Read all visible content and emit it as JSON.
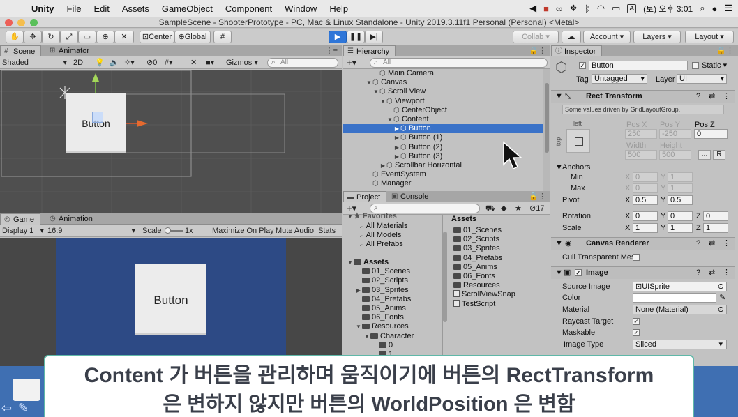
{
  "menubar": {
    "items": [
      "Unity",
      "File",
      "Edit",
      "Assets",
      "GameObject",
      "Component",
      "Window",
      "Help"
    ],
    "keyboard": "A",
    "datetime": "(토) 오후 3:01"
  },
  "window": {
    "title": "SampleScene - ShooterPrototype - PC, Mac & Linux Standalone - Unity 2019.3.11f1 Personal (Personal) <Metal>"
  },
  "toolbar": {
    "pivot": "Center",
    "space": "Global",
    "collab": "Collab",
    "account": "Account",
    "layers": "Layers",
    "layout": "Layout"
  },
  "scene": {
    "tabs": [
      "Scene",
      "Animator"
    ],
    "shading": "Shaded",
    "mode_2d": "2D",
    "hidden_count": "0",
    "gizmos": "Gizmos",
    "search_placeholder": "All",
    "button_label": "Button"
  },
  "game": {
    "tabs": [
      "Game",
      "Animation"
    ],
    "display": "Display 1",
    "aspect": "16:9",
    "scale_label": "Scale",
    "scale_value": "1x",
    "maximize": "Maximize On Play",
    "mute": "Mute Audio",
    "stats": "Stats",
    "button_label": "Button"
  },
  "hierarchy": {
    "tab": "Hierarchy",
    "search_placeholder": "All",
    "items": [
      {
        "label": "Main Camera",
        "depth": 2,
        "arrow": ""
      },
      {
        "label": "Canvas",
        "depth": 1,
        "arrow": "▼"
      },
      {
        "label": "Scroll View",
        "depth": 2,
        "arrow": "▼"
      },
      {
        "label": "Viewport",
        "depth": 3,
        "arrow": "▼"
      },
      {
        "label": "CenterObject",
        "depth": 4,
        "arrow": ""
      },
      {
        "label": "Content",
        "depth": 4,
        "arrow": "▼"
      },
      {
        "label": "Button",
        "depth": 5,
        "arrow": "▶",
        "selected": true
      },
      {
        "label": "Button (1)",
        "depth": 5,
        "arrow": "▶"
      },
      {
        "label": "Button (2)",
        "depth": 5,
        "arrow": "▶"
      },
      {
        "label": "Button (3)",
        "depth": 5,
        "arrow": "▶"
      },
      {
        "label": "Scrollbar Horizontal",
        "depth": 3,
        "arrow": "▶"
      },
      {
        "label": "EventSystem",
        "depth": 1,
        "arrow": ""
      },
      {
        "label": "Manager",
        "depth": 1,
        "arrow": ""
      }
    ]
  },
  "project": {
    "tabs": [
      "Project",
      "Console"
    ],
    "hidden_count": "17",
    "favorites_label": "Favorites",
    "favorites": [
      "All Materials",
      "All Models",
      "All Prefabs"
    ],
    "tree": [
      {
        "label": "Assets",
        "depth": 0,
        "arrow": "▼",
        "bold": true
      },
      {
        "label": "01_Scenes",
        "depth": 1,
        "arrow": ""
      },
      {
        "label": "02_Scripts",
        "depth": 1,
        "arrow": ""
      },
      {
        "label": "03_Sprites",
        "depth": 1,
        "arrow": "▶"
      },
      {
        "label": "04_Prefabs",
        "depth": 1,
        "arrow": ""
      },
      {
        "label": "05_Anims",
        "depth": 1,
        "arrow": ""
      },
      {
        "label": "06_Fonts",
        "depth": 1,
        "arrow": ""
      },
      {
        "label": "Resources",
        "depth": 1,
        "arrow": "▼"
      },
      {
        "label": "Character",
        "depth": 2,
        "arrow": "▼"
      },
      {
        "label": "0",
        "depth": 3,
        "arrow": ""
      },
      {
        "label": "1",
        "depth": 3,
        "arrow": ""
      }
    ],
    "assets_header": "Assets",
    "assets": [
      {
        "label": "01_Scenes",
        "kind": "folder"
      },
      {
        "label": "02_Scripts",
        "kind": "folder"
      },
      {
        "label": "03_Sprites",
        "kind": "folder"
      },
      {
        "label": "04_Prefabs",
        "kind": "folder"
      },
      {
        "label": "05_Anims",
        "kind": "folder"
      },
      {
        "label": "06_Fonts",
        "kind": "folder"
      },
      {
        "label": "Resources",
        "kind": "folder"
      },
      {
        "label": "ScrollViewSnap",
        "kind": "script"
      },
      {
        "label": "TestScript",
        "kind": "script"
      }
    ]
  },
  "inspector": {
    "tab": "Inspector",
    "object_name": "Button",
    "static_label": "Static",
    "tag_label": "Tag",
    "tag_value": "Untagged",
    "layer_label": "Layer",
    "layer_value": "UI",
    "rect_transform": {
      "title": "Rect Transform",
      "note": "Some values driven by GridLayoutGroup.",
      "anchor_h": "left",
      "anchor_v": "top",
      "pos_x_label": "Pos X",
      "pos_y_label": "Pos Y",
      "pos_z_label": "Pos Z",
      "pos_x": "250",
      "pos_y": "-250",
      "pos_z": "0",
      "width_label": "Width",
      "height_label": "Height",
      "width": "500",
      "height": "500",
      "r_button": "R",
      "anchors_label": "Anchors",
      "min_label": "Min",
      "max_label": "Max",
      "min_x": "0",
      "min_y": "1",
      "max_x": "0",
      "max_y": "1",
      "pivot_label": "Pivot",
      "pivot_x": "0.5",
      "pivot_y": "0.5",
      "rotation_label": "Rotation",
      "rot_x": "0",
      "rot_y": "0",
      "rot_z": "0",
      "scale_label": "Scale",
      "scale_x": "1",
      "scale_y": "1",
      "scale_z": "1",
      "x": "X",
      "y": "Y",
      "z": "Z"
    },
    "canvas_renderer": {
      "title": "Canvas Renderer",
      "cull_label": "Cull Transparent Mes"
    },
    "image": {
      "title": "Image",
      "source_label": "Source Image",
      "source_value": "UISprite",
      "color_label": "Color",
      "material_label": "Material",
      "material_value": "None (Material)",
      "raycast_label": "Raycast Target",
      "maskable_label": "Maskable",
      "type_label": "Image Type",
      "type_value": "Sliced"
    }
  },
  "subtitle": {
    "line1": "Content 가 버튼을 관리하며 움직이기에 버튼의 RectTransform",
    "line2": "은 변하지 않지만 버튼의 WorldPosition 은 변함"
  },
  "colors": {
    "selection": "#3a72c8",
    "play": "#2f76d8",
    "game_bg": "#2d4a85",
    "subtitle_border": "#5fb8a8"
  }
}
